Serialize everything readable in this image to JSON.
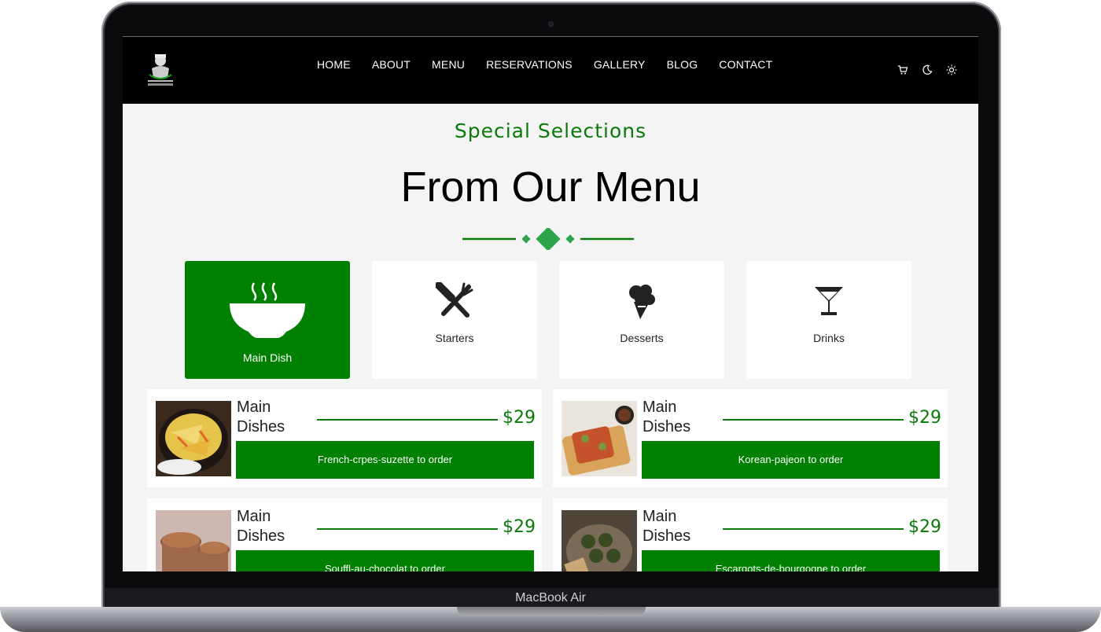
{
  "device": {
    "brand_label": "MacBook Air"
  },
  "nav": {
    "links": [
      "HOME",
      "ABOUT",
      "MENU",
      "RESERVATIONS",
      "GALLERY",
      "BLOG",
      "CONTACT"
    ],
    "icons": [
      "cart-icon",
      "moon-icon",
      "sun-icon"
    ]
  },
  "section": {
    "kicker": "Special Selections",
    "title": "From Our Menu"
  },
  "categories": [
    {
      "label": "Main Dish",
      "icon": "bowl-icon",
      "active": true
    },
    {
      "label": "Starters",
      "icon": "utensils-icon",
      "active": false
    },
    {
      "label": "Desserts",
      "icon": "ice-cream-icon",
      "active": false
    },
    {
      "label": "Drinks",
      "icon": "cocktail-icon",
      "active": false
    }
  ],
  "items": [
    {
      "title": "Main Dishes",
      "price": "$29",
      "button": "French-crpes-suzette to order"
    },
    {
      "title": "Main Dishes",
      "price": "$29",
      "button": "Korean-pajeon to order"
    },
    {
      "title": "Main Dishes",
      "price": "$29",
      "button": "Souffl-au-chocolat to order"
    },
    {
      "title": "Main Dishes",
      "price": "$29",
      "button": "Escargots-de-bourgogne to order"
    }
  ],
  "colors": {
    "accent": "#008000",
    "accent_text": "#0a7a0a",
    "navbar": "#000000"
  }
}
